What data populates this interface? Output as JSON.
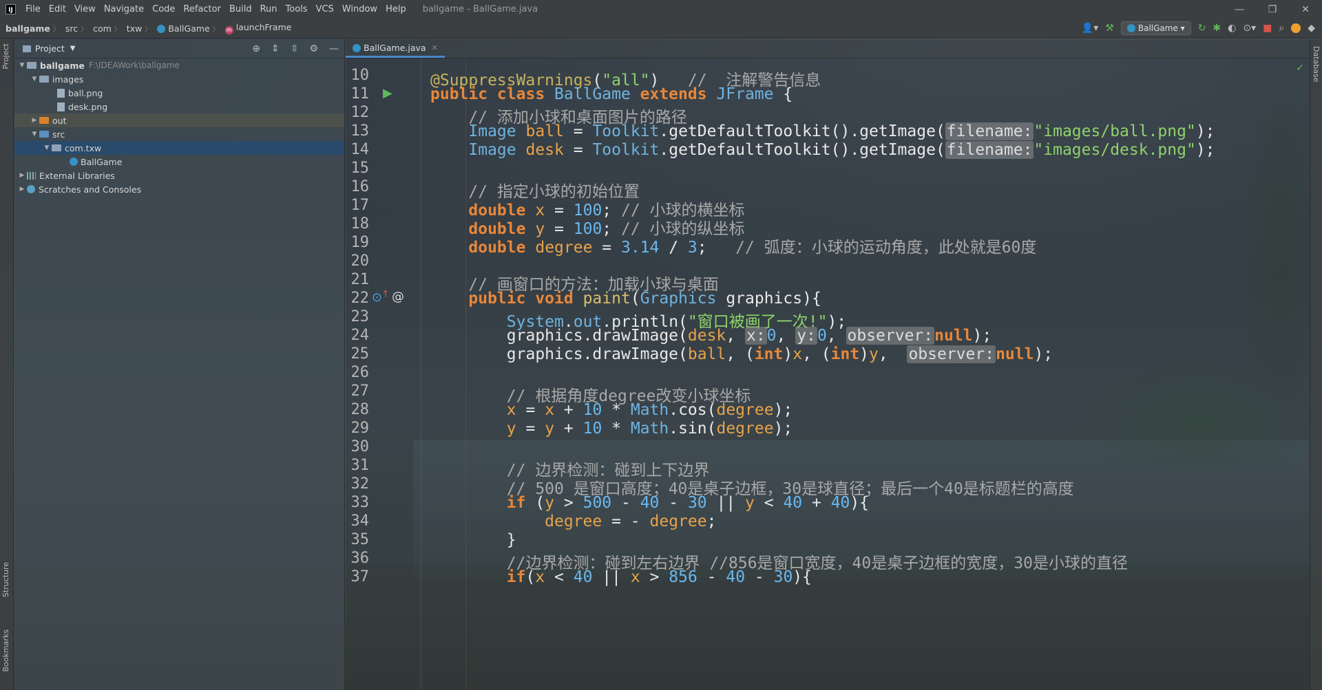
{
  "window": {
    "logo_text": "IJ",
    "title": "ballgame - BallGame.java",
    "menu": [
      "File",
      "Edit",
      "View",
      "Navigate",
      "Code",
      "Refactor",
      "Build",
      "Run",
      "Tools",
      "VCS",
      "Window",
      "Help"
    ],
    "controls": {
      "minimize": "—",
      "maximize": "❐",
      "close": "✕"
    }
  },
  "navbar": {
    "breadcrumbs": [
      "ballgame",
      "src",
      "com",
      "txw",
      "BallGame",
      "launchFrame"
    ],
    "run_config": "BallGame"
  },
  "left_strip": {
    "project_tab": "Project",
    "structure_tab": "Structure",
    "bookmarks_tab": "Bookmarks"
  },
  "right_strip": {
    "database_tab": "Database"
  },
  "project_panel": {
    "title": "Project",
    "tree": [
      {
        "label": "ballgame",
        "path": "F:\\IDEAWork\\ballgame"
      },
      {
        "label": "images"
      },
      {
        "label": "ball.png"
      },
      {
        "label": "desk.png"
      },
      {
        "label": "out"
      },
      {
        "label": "src"
      },
      {
        "label": "com.txw"
      },
      {
        "label": "BallGame"
      },
      {
        "label": "External Libraries"
      },
      {
        "label": "Scratches and Consoles"
      }
    ]
  },
  "editor": {
    "tab": "BallGame.java",
    "line_numbers": [
      "10",
      "11",
      "12",
      "13",
      "14",
      "15",
      "16",
      "17",
      "18",
      "19",
      "20",
      "21",
      "22",
      "23",
      "24",
      "25",
      "26",
      "27",
      "28",
      "29",
      "30",
      "31",
      "32",
      "33",
      "34",
      "35",
      "36",
      "37"
    ]
  },
  "colors": {
    "accent": "#4a88c7",
    "keyword": "#e8873a",
    "string": "#8fd36b",
    "number": "#6ab8f0",
    "selection": "#264b6e"
  }
}
